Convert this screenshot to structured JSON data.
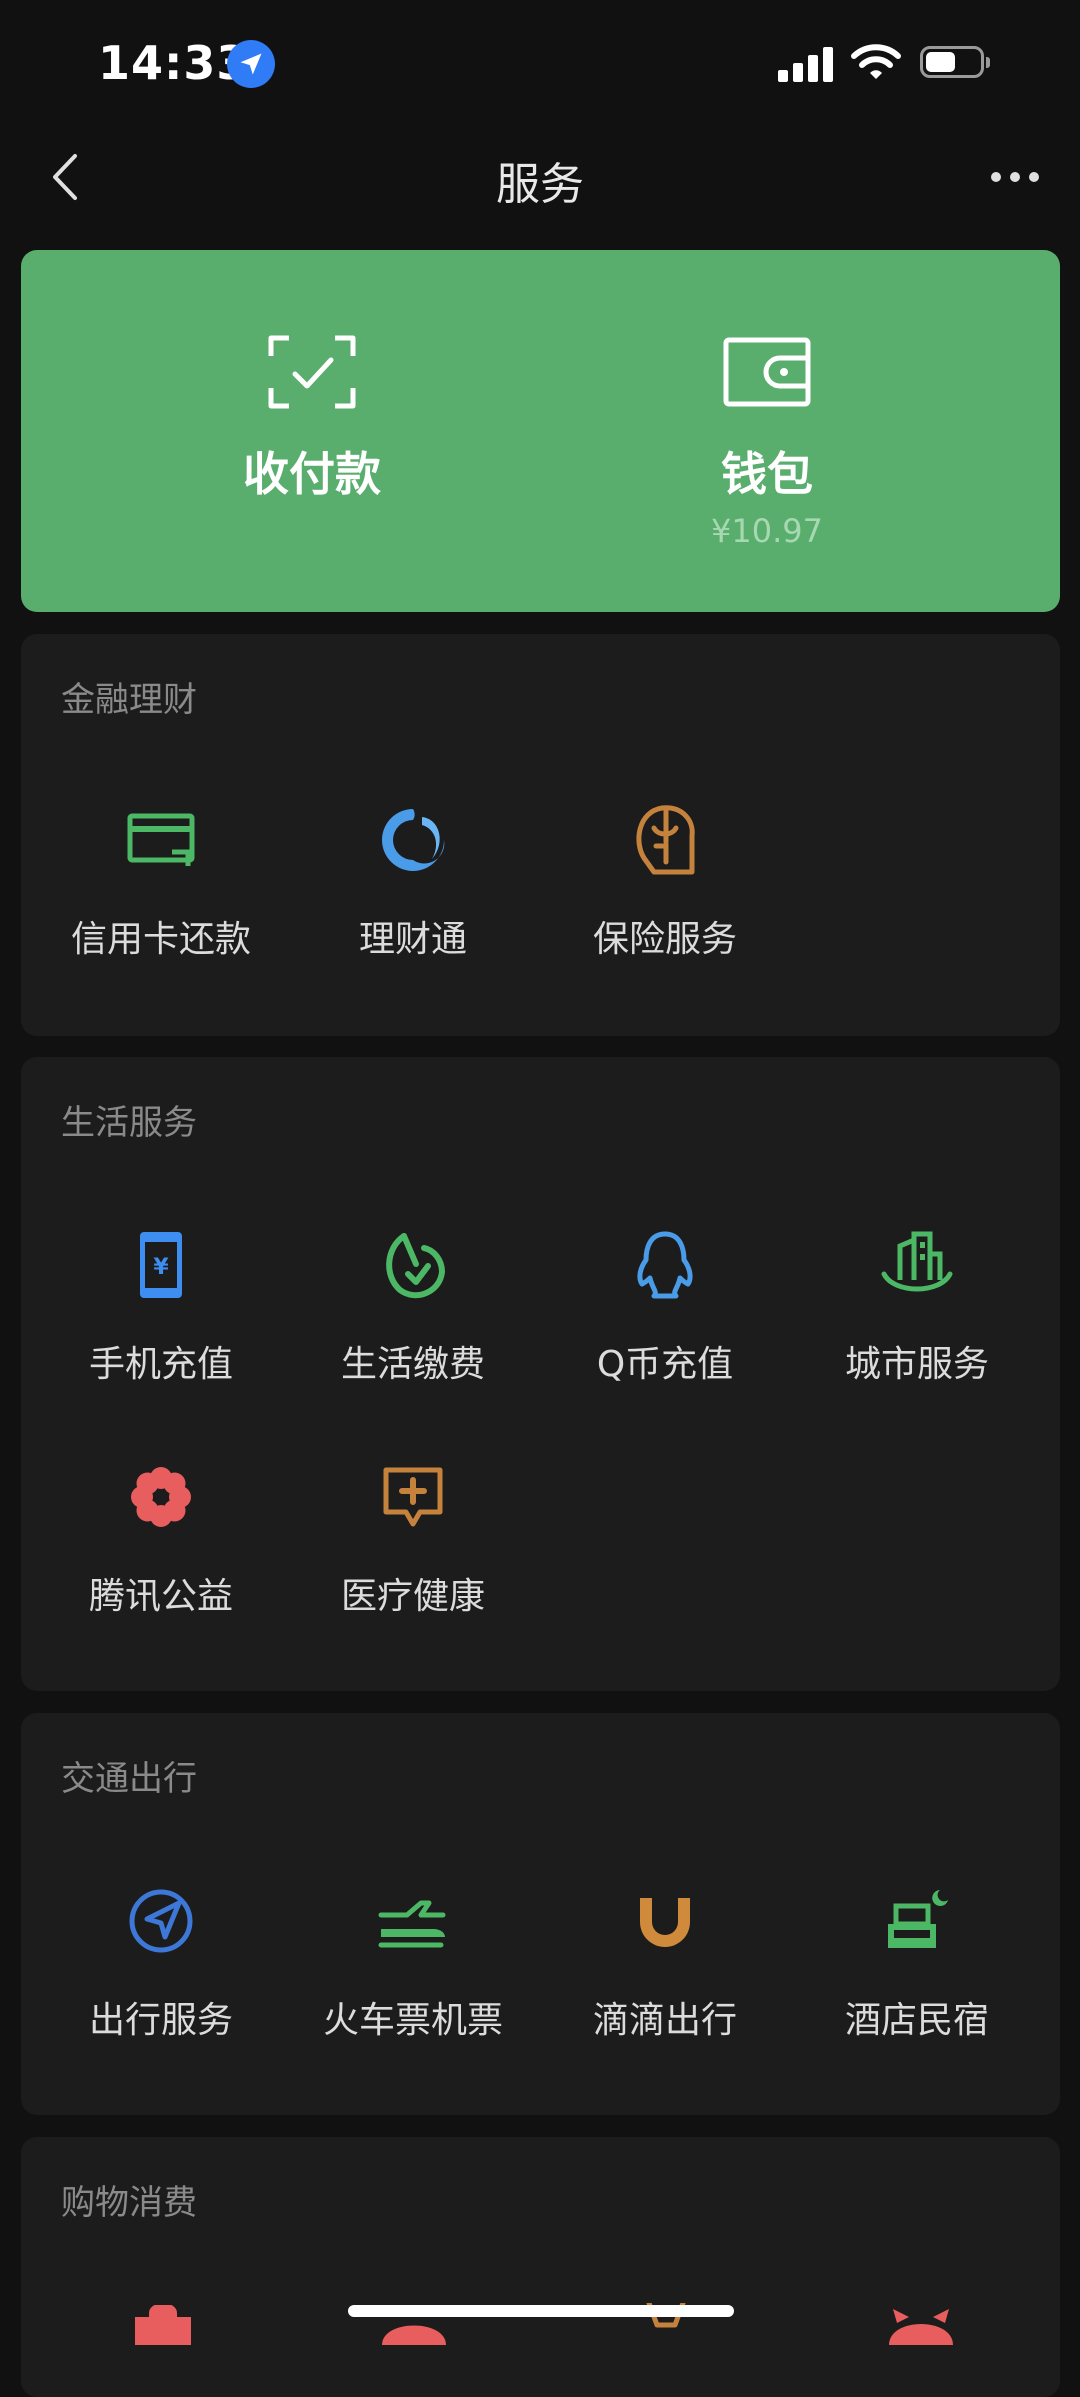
{
  "status_bar": {
    "time": "14:33",
    "battery_level": 0.55
  },
  "nav": {
    "title": "服务"
  },
  "top_card": {
    "pay": {
      "label": "收付款",
      "icon": "scan-pay-icon"
    },
    "wallet": {
      "label": "钱包",
      "balance": "¥10.97",
      "icon": "wallet-icon"
    },
    "color": "#59ad6d"
  },
  "sections": [
    {
      "title": "金融理财",
      "items": [
        {
          "label": "信用卡还款",
          "icon": "credit-card-icon",
          "color": "#4cb865"
        },
        {
          "label": "理财通",
          "icon": "wealth-icon",
          "color": "#4a9be8"
        },
        {
          "label": "保险服务",
          "icon": "insurance-icon",
          "color": "#c4823d"
        }
      ]
    },
    {
      "title": "生活服务",
      "items": [
        {
          "label": "手机充值",
          "icon": "phone-topup-icon",
          "color": "#3d8ef0"
        },
        {
          "label": "生活缴费",
          "icon": "utility-bill-icon",
          "color": "#4cb865"
        },
        {
          "label": "Q币充值",
          "icon": "qq-penguin-icon",
          "color": "#4a9be8"
        },
        {
          "label": "城市服务",
          "icon": "city-service-icon",
          "color": "#4cb865"
        },
        {
          "label": "腾讯公益",
          "icon": "charity-flower-icon",
          "color": "#e85d5d"
        },
        {
          "label": "医疗健康",
          "icon": "medical-icon",
          "color": "#c4823d"
        }
      ]
    },
    {
      "title": "交通出行",
      "items": [
        {
          "label": "出行服务",
          "icon": "travel-compass-icon",
          "color": "#3d78d8"
        },
        {
          "label": "火车票机票",
          "icon": "train-plane-icon",
          "color": "#4cb865"
        },
        {
          "label": "滴滴出行",
          "icon": "didi-icon",
          "color": "#d08a3c"
        },
        {
          "label": "酒店民宿",
          "icon": "hotel-bed-icon",
          "color": "#4cb865"
        }
      ]
    },
    {
      "title": "购物消费",
      "items": []
    }
  ]
}
